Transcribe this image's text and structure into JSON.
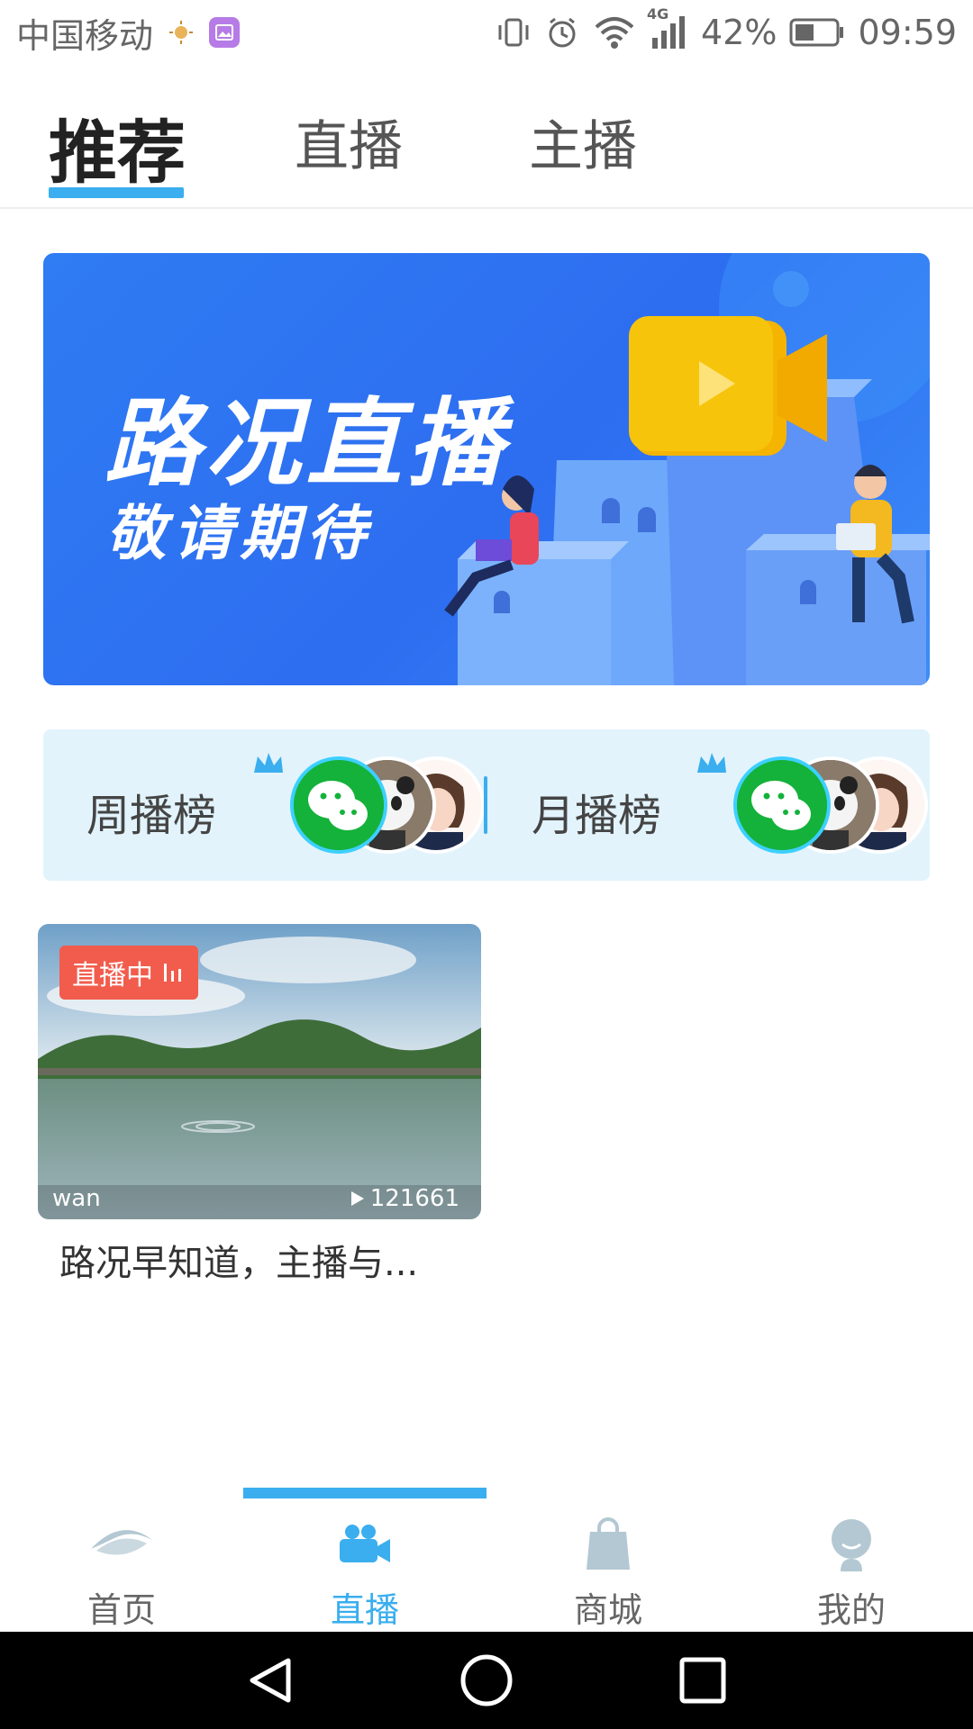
{
  "status_bar": {
    "carrier": "中国移动",
    "network": "4G",
    "battery": "42%",
    "time": "09:59",
    "icons": [
      "weather-icon",
      "gallery-icon",
      "vibrate-icon",
      "alarm-icon",
      "wifi-icon",
      "signal-icon",
      "battery-icon"
    ]
  },
  "top_tabs": [
    {
      "label": "推荐",
      "active": true
    },
    {
      "label": "直播",
      "active": false
    },
    {
      "label": "主播",
      "active": false
    }
  ],
  "banner": {
    "title": "路况直播",
    "subtitle": "敬请期待"
  },
  "rankings": {
    "weekly_label": "周播榜",
    "monthly_label": "月播榜",
    "accent_color": "#3aaeee"
  },
  "live_card": {
    "badge": "直播中",
    "user": "wan",
    "views": "121661",
    "title": "路况早知道，主播与..."
  },
  "bottom_nav": [
    {
      "label": "首页",
      "icon": "eye-icon",
      "active": false
    },
    {
      "label": "直播",
      "icon": "video-camera-icon",
      "active": true
    },
    {
      "label": "商城",
      "icon": "shopping-bag-icon",
      "active": false
    },
    {
      "label": "我的",
      "icon": "person-icon",
      "active": false
    }
  ],
  "colors": {
    "accent": "#3aaeee",
    "banner_blue": "#2d6df0",
    "live_red": "#f25c4c",
    "inactive_icon": "#b3c8d2"
  }
}
